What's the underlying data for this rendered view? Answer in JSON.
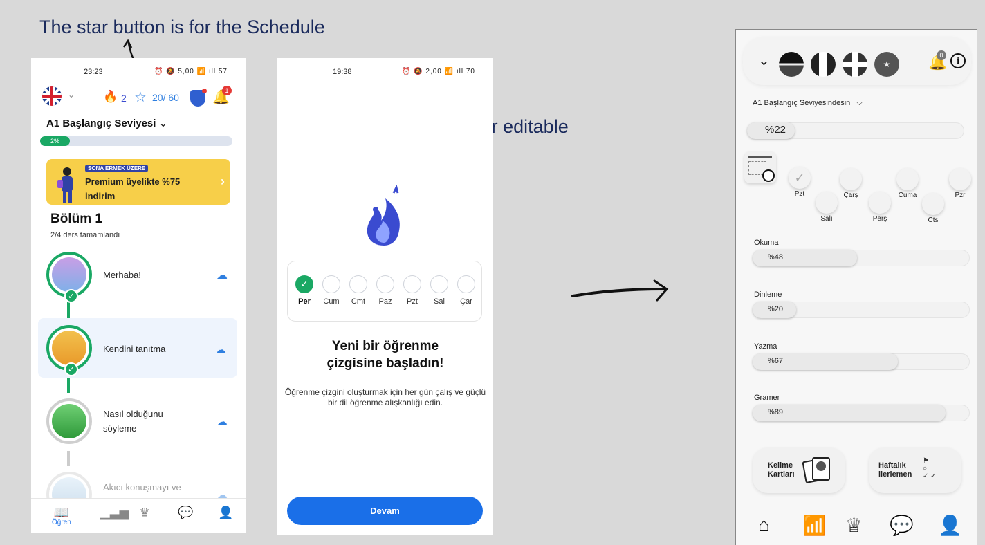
{
  "annotations": {
    "star_note": "The star button is for the Schedule",
    "days_note": "Days are not clickable or editable"
  },
  "phone1": {
    "status_time": "23:23",
    "status_icons": "⏰ 🔕 5,00 📶 ıll 57",
    "streak": "2",
    "stars": "20/ 60",
    "notification_count": "1",
    "level_title": "A1 Başlangıç Seviyesi",
    "progress_label": "2%",
    "progress_value": 2,
    "promo_badge": "SONA ERMEK ÜZERE",
    "promo_text": "Premium üyelikte %75 indirim",
    "section_title": "Bölüm 1",
    "section_subtitle": "2/4 ders tamamlandı",
    "lessons": [
      {
        "name": "Merhaba!",
        "done": true
      },
      {
        "name": "Kendini tanıtma",
        "done": true
      },
      {
        "name": "Nasıl olduğunu söyleme",
        "done": false
      },
      {
        "name": "Akıcı konuşmayı ve",
        "done": false
      }
    ],
    "nav_learn": "Öğren"
  },
  "phone2": {
    "status_time": "19:38",
    "status_icons": "⏰ 🔕 2,00 📶 ıll 70",
    "days": [
      {
        "label": "Per",
        "done": true
      },
      {
        "label": "Cum",
        "done": false
      },
      {
        "label": "Cmt",
        "done": false
      },
      {
        "label": "Paz",
        "done": false
      },
      {
        "label": "Pzt",
        "done": false
      },
      {
        "label": "Sal",
        "done": false
      },
      {
        "label": "Çar",
        "done": false
      }
    ],
    "title": "Yeni bir öğrenme çizgisine başladın!",
    "description": "Öğrenme çizgini oluşturmak için her gün çalış ve güçlü bir dil öğrenme alışkanlığı edin.",
    "button": "Devam"
  },
  "phone3": {
    "notification_count": "0",
    "level_title": "A1 Başlangıç Seviyesindesin",
    "overall_progress": "%22",
    "overall_value": 22,
    "days": {
      "pzt": "Pzt",
      "sali": "Salı",
      "cars": "Çarş",
      "pers": "Perş",
      "cuma": "Cuma",
      "cts": "Cts",
      "pzr": "Pzr"
    },
    "skills": [
      {
        "label": "Okuma",
        "value_text": "%48",
        "value": 48
      },
      {
        "label": "Dinleme",
        "value_text": "%20",
        "value": 20
      },
      {
        "label": "Yazma",
        "value_text": "%67",
        "value": 67
      },
      {
        "label": "Gramer",
        "value_text": "%89",
        "value": 89
      }
    ],
    "card_words": "Kelime Kartları",
    "card_weekly": "Haftalık ilerlemen"
  },
  "colors": {
    "green": "#1aa864",
    "blue": "#1a6fe8",
    "promo_yellow": "#f7cf49",
    "annotation": "#1a2a5c"
  }
}
